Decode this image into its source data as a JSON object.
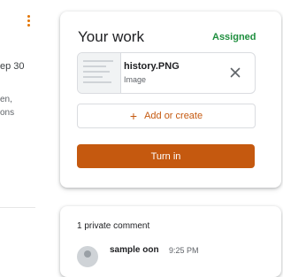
{
  "sidebar": {
    "menu_icon": "more-vert-icon",
    "date": "ep 30",
    "snippet_line1": "en,",
    "snippet_line2": "ons"
  },
  "your_work": {
    "title": "Your work",
    "status": "Assigned",
    "status_color": "#1e8e3e",
    "attachment": {
      "name": "history.PNG",
      "type": "Image",
      "remove_icon": "close-icon"
    },
    "add_create_label": "Add or create",
    "add_icon": "plus-icon",
    "turn_in_label": "Turn in",
    "accent_color": "#c5590f"
  },
  "comments": {
    "heading": "1 private comment",
    "items": [
      {
        "author": "sample oon",
        "time": "9:25 PM"
      }
    ]
  }
}
